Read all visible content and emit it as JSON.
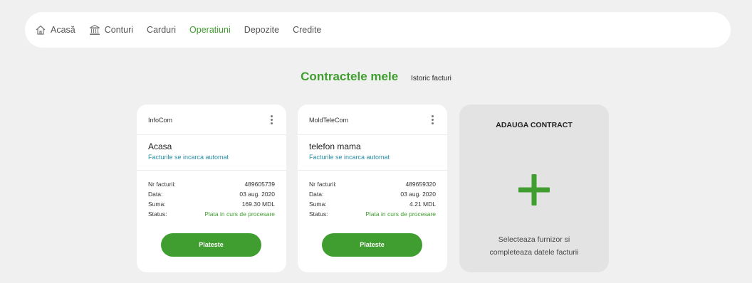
{
  "nav": {
    "items": [
      {
        "label": "Acasă",
        "icon": "home-icon"
      },
      {
        "label": "Conturi",
        "icon": "bank-icon"
      },
      {
        "label": "Carduri"
      },
      {
        "label": "Operatiuni",
        "active": true
      },
      {
        "label": "Depozite"
      },
      {
        "label": "Credite"
      }
    ],
    "active_color": "#3f9e2f"
  },
  "heading": {
    "title": "Contractele mele",
    "history_link": "Istoric facturi"
  },
  "labels": {
    "nr": "Nr facturii:",
    "date": "Data:",
    "sum": "Suma:",
    "status": "Status:"
  },
  "contracts": [
    {
      "provider": "InfoCom",
      "name": "Acasa",
      "auto_note": "Facturile se incarca automat",
      "nr": "489605739",
      "date": "03 aug. 2020",
      "sum": "169.30 MDL",
      "status": "Plata in curs de procesare",
      "pay_label": "Plateste"
    },
    {
      "provider": "MoldTeleCom",
      "name": "telefon mama",
      "auto_note": "Facturile se incarca automat",
      "nr": "489659320",
      "date": "03 aug. 2020",
      "sum": "4.21 MDL",
      "status": "Plata in curs de procesare",
      "pay_label": "Plateste"
    }
  ],
  "add_contract": {
    "title": "ADAUGA CONTRACT",
    "icon": "plus-icon",
    "desc_line1": "Selecteaza furnizor si",
    "desc_line2": "completeaza datele facturii"
  },
  "colors": {
    "accent": "#3f9e2f",
    "link": "#2a8fa8",
    "background": "#f0f0f0"
  }
}
